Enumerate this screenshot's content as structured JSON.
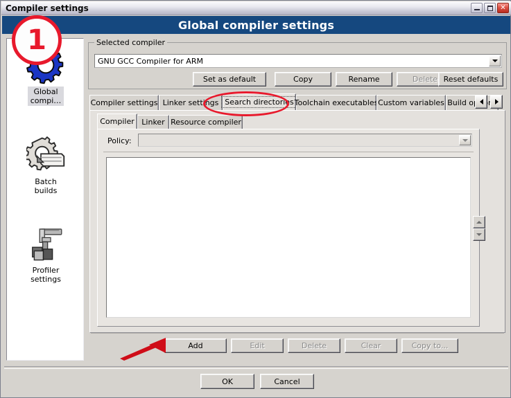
{
  "window": {
    "title": "Compiler settings",
    "header_title": "Global compiler settings",
    "caption_buttons": {
      "minimize": "minimize-icon",
      "maximize": "maximize-icon",
      "close": "✕"
    }
  },
  "sidebar": {
    "items": [
      {
        "label": "Global\ncompi…",
        "label_line1": "Global",
        "label_line2": "compi…",
        "icon": "blue-gear-icon",
        "selected": true
      },
      {
        "label": "Batch\nbuilds",
        "label_line1": "Batch",
        "label_line2": "builds",
        "icon": "gear-stack-icon",
        "selected": false
      },
      {
        "label": "Profiler\nsettings",
        "label_line1": "Profiler",
        "label_line2": "settings",
        "icon": "caliper-icon",
        "selected": false
      }
    ]
  },
  "selected_compiler": {
    "group_title": "Selected compiler",
    "combo_value": "GNU GCC Compiler for ARM",
    "buttons": [
      {
        "label": "Set as default",
        "enabled": true
      },
      {
        "label": "Copy",
        "enabled": true
      },
      {
        "label": "Rename",
        "enabled": true
      },
      {
        "label": "Delete",
        "enabled": false
      },
      {
        "label": "Reset defaults",
        "enabled": true
      }
    ]
  },
  "outer_tabs": {
    "items": [
      {
        "label": "Compiler settings",
        "selected": false
      },
      {
        "label": "Linker settings",
        "selected": false
      },
      {
        "label": "Search directories",
        "selected": true
      },
      {
        "label": "Toolchain executables",
        "selected": false
      },
      {
        "label": "Custom variables",
        "selected": false
      },
      {
        "label": "Build options",
        "selected": false
      }
    ],
    "nav_prev": "scroll-left-icon",
    "nav_next": "scroll-right-icon"
  },
  "inner_tabs": {
    "items": [
      {
        "label": "Compiler",
        "selected": true
      },
      {
        "label": "Linker",
        "selected": false
      },
      {
        "label": "Resource compiler",
        "selected": false
      }
    ]
  },
  "policy": {
    "label": "Policy:",
    "value": "",
    "enabled": false
  },
  "directory_list": {
    "entries": []
  },
  "list_spinner": {
    "up": "move-up-icon",
    "down": "move-down-icon"
  },
  "action_buttons": [
    {
      "label": "Add",
      "enabled": true
    },
    {
      "label": "Edit",
      "enabled": false
    },
    {
      "label": "Delete",
      "enabled": false
    },
    {
      "label": "Clear",
      "enabled": false
    },
    {
      "label": "Copy to...",
      "enabled": false
    }
  ],
  "dialog_buttons": [
    {
      "label": "OK",
      "enabled": true
    },
    {
      "label": "Cancel",
      "enabled": true
    }
  ],
  "annotations": {
    "step_number": "1",
    "highlight_color": "#e8192c",
    "circled_tab": "Search directories",
    "arrow_target": "Add"
  },
  "colors": {
    "header_blue": "#15487f",
    "dialog_face": "#d6d3ce",
    "annotation_red": "#e8192c"
  }
}
